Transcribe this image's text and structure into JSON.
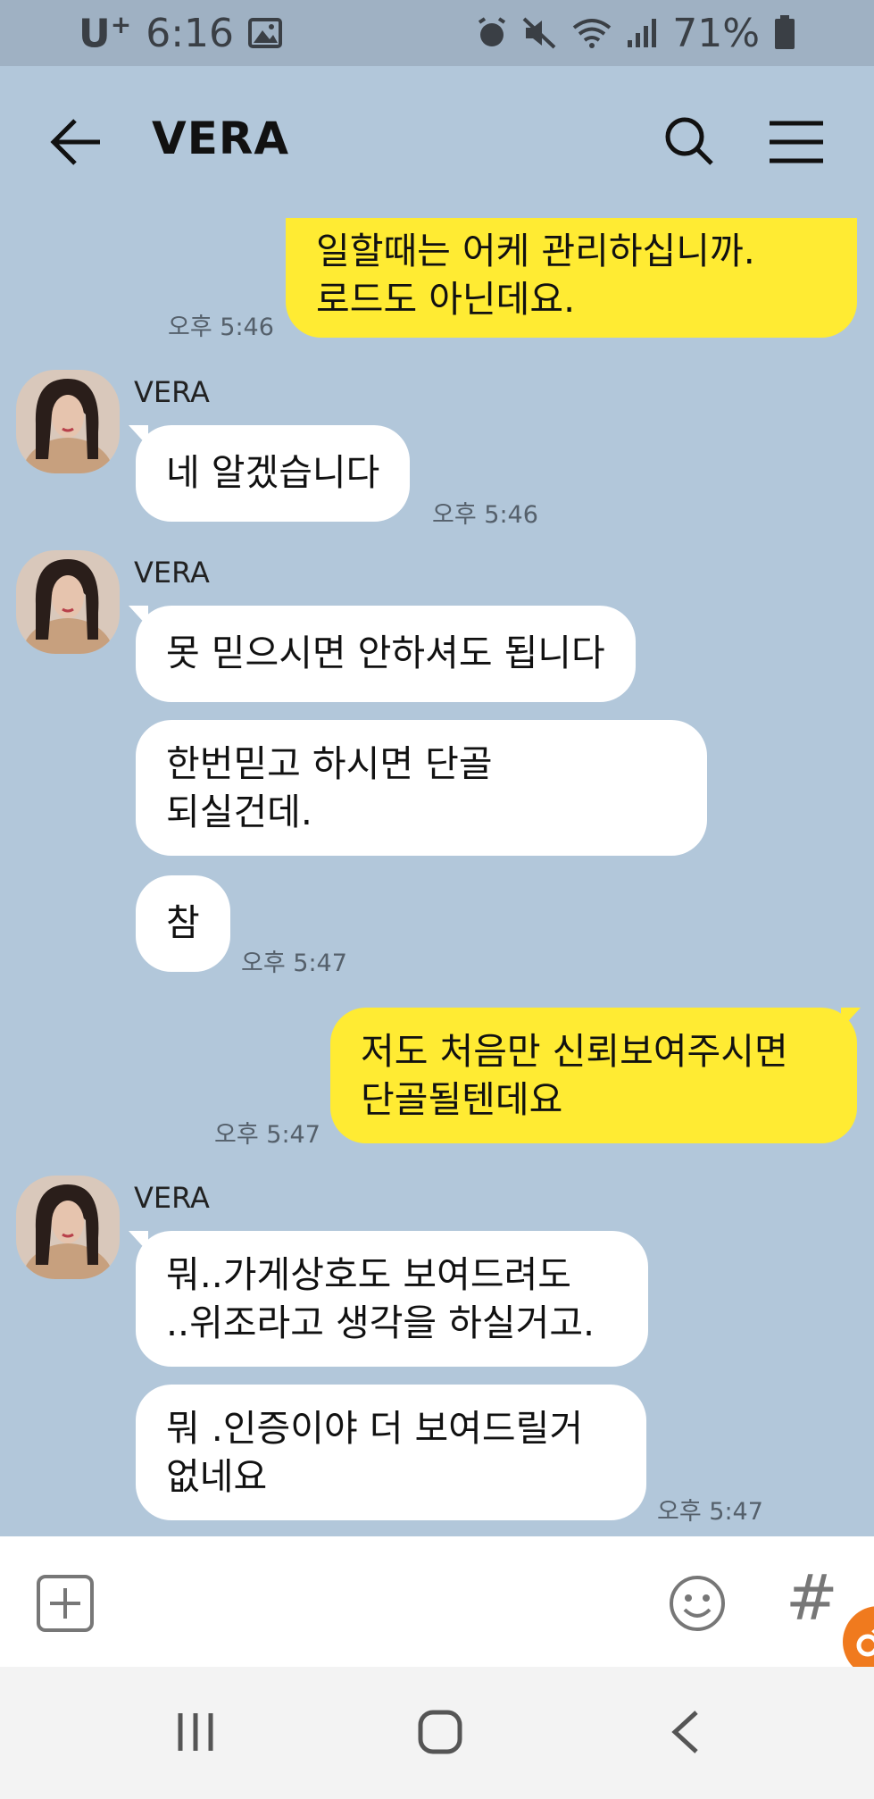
{
  "status_bar": {
    "carrier": "U",
    "carrier_plus": "+",
    "time": "6:16",
    "battery": "71%"
  },
  "header": {
    "title": "VERA"
  },
  "messages": [
    {
      "from": "me",
      "text": "일할때는 어케 관리하십니까.\n로드도 아닌데요.",
      "time": "오후 5:46"
    },
    {
      "from": "them",
      "sender": "VERA",
      "text": "네 알겠습니다",
      "time": "오후 5:46"
    },
    {
      "from": "them",
      "sender": "VERA",
      "text": "못 믿으시면 안하셔도 됩니다"
    },
    {
      "from": "them",
      "text": "한번믿고 하시면 단골\n되실건데."
    },
    {
      "from": "them",
      "text": "참",
      "time": "오후 5:47"
    },
    {
      "from": "me",
      "text": "저도 처음만 신뢰보여주시면\n단골될텐데요",
      "time": "오후 5:47"
    },
    {
      "from": "them",
      "sender": "VERA",
      "text": "뭐..가게상호도 보여드려도\n..위조라고 생각을 하실거고."
    },
    {
      "from": "them",
      "text": "뭐 .인증이야 더 보여드릴거\n없네요",
      "time": "오후 5:47"
    }
  ],
  "input_bar": {
    "hash_symbol": "#"
  },
  "colors": {
    "background": "#b2c7da",
    "my_bubble": "#ffeb33",
    "their_bubble": "#ffffff",
    "fab": "#f07a1e"
  }
}
